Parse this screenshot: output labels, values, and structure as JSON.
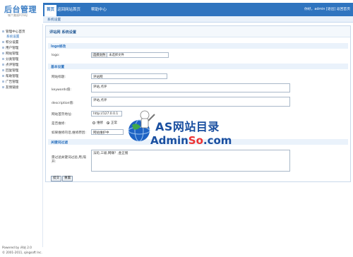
{
  "logo": {
    "title": "后台管理",
    "subtitle": "城个美丽FOSSJ"
  },
  "topnav": {
    "tabs": [
      "首页",
      "返回网站首页",
      "帮助中心"
    ],
    "user_text": "你好，admin [退出]  返回首页"
  },
  "breadcrumb": "系统设置",
  "sidebar": {
    "items": [
      "管理中心首页",
      "系统设置",
      "积分设置",
      "用户管理",
      "网站管理",
      "分类管理",
      "点评管理",
      "回复管理",
      "帮助管理",
      "广告管理",
      "友情链接"
    ],
    "footer_line1": "Powered by 评站 2.0",
    "footer_line2": "© 2001-2011, qingsoft Inc."
  },
  "panel_title": "评站网 系统设置",
  "sections": {
    "logo": "logo修改",
    "basic": "基本设置",
    "filter": "关键词过滤"
  },
  "form": {
    "logo_label": "logo:",
    "file_button": "选择文件",
    "file_status": "未选择文件",
    "site_title_label": "网站标题:",
    "site_title_value": "评站网",
    "keywords_label": "keywords值:",
    "keywords_value": "评站,点评",
    "description_label": "description值:",
    "description_value": "评站,点评",
    "url_label": "网站首页地址:",
    "url_value": "http://127.0.0.1",
    "maintain_label": "是否维修:",
    "radio_on": "维修",
    "radio_off": "正常",
    "maintain_reason_label": "如果维修的话,维修原因:",
    "maintain_reason_value": "网站维护中",
    "filter_label": "需过滤关键词过滤,用,隔开:",
    "filter_value": "法轮,三级,网赚？,金正猪"
  },
  "buttons": {
    "submit": "提交",
    "reset": "重置"
  },
  "watermark": {
    "cn": "AS网站目录",
    "en_a": "Admin",
    "en_b": "So",
    "en_c": ".com"
  },
  "colors": {
    "nav_blue": "#2f74bf",
    "section_bg": "#eaf2fb"
  }
}
